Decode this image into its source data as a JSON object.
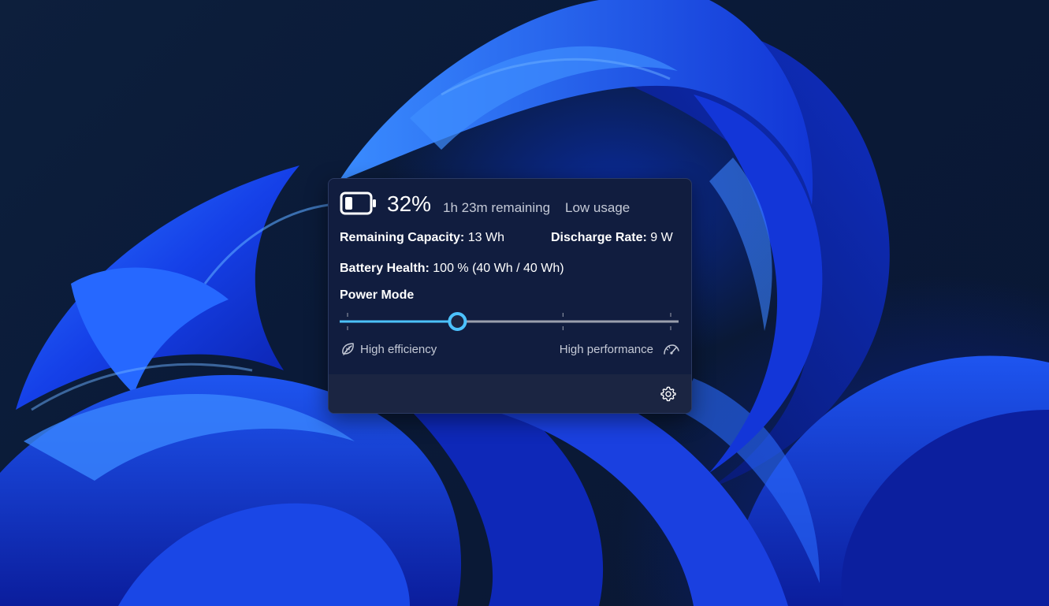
{
  "battery": {
    "percent_text": "32%",
    "percent_value": 32,
    "time_remaining": "1h 23m remaining",
    "usage": "Low usage"
  },
  "stats": {
    "capacity_label": "Remaining Capacity:",
    "capacity_value": "13 Wh",
    "discharge_label": "Discharge Rate:",
    "discharge_value": "9 W",
    "health_label": "Battery Health:",
    "health_value": "100 % (40 Wh / 40 Wh)"
  },
  "power_mode": {
    "title": "Power Mode",
    "low_label": "High efficiency",
    "high_label": "High performance",
    "slider_fraction": 0.34,
    "tick_count": 4
  },
  "icons": {
    "battery": "battery-icon",
    "efficiency": "leaf-icon",
    "performance": "gauge-icon",
    "settings": "gear-icon"
  },
  "colors": {
    "accent": "#4cc2ff",
    "panel": "#111d3f",
    "footer": "#1b2542",
    "muted_text": "#c4c9d6"
  }
}
